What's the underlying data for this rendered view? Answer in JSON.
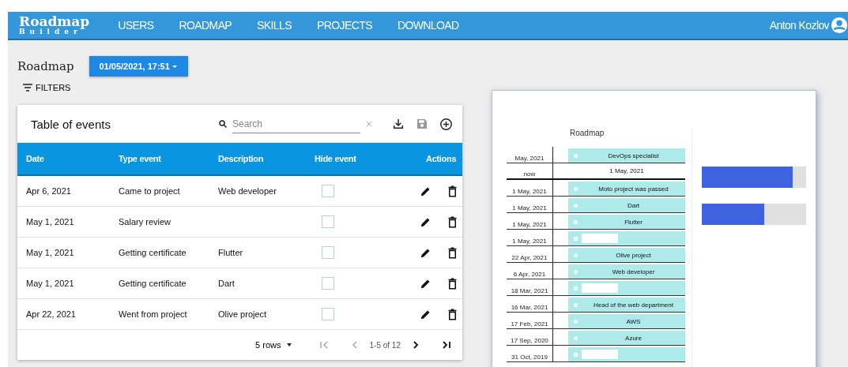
{
  "header": {
    "logo": {
      "title": "Roadmap",
      "subtitle": "Builder"
    },
    "nav": [
      {
        "label": "USERS",
        "selected": false
      },
      {
        "label": "ROADMAP",
        "selected": false
      },
      {
        "label": "SKILLS",
        "selected": false
      },
      {
        "label": "PROJECTS",
        "selected": false
      },
      {
        "label": "DOWNLOAD",
        "selected": false
      }
    ],
    "user": "Anton Kozlov"
  },
  "page_title": "Roadmap",
  "date_button": "01/05/2021, 17:51",
  "filters_button": "FILTERS",
  "table": {
    "title": "Table of events",
    "search": {
      "placeholder": "Search"
    },
    "columns": [
      "Date",
      "Type event",
      "Description",
      "Hide event",
      "Actions"
    ],
    "rows": [
      {
        "date": "Apr 6, 2021",
        "type": "Came to project",
        "description": "Web developer",
        "hidden": false
      },
      {
        "date": "May 1, 2021",
        "type": "Salary review",
        "hidden": false
      },
      {
        "date": "May 1, 2021",
        "type": "Getting certificate",
        "description": "Flutter",
        "hidden": false
      },
      {
        "date": "May 1, 2021",
        "type": "Getting certificate",
        "description": "Dart",
        "hidden": false
      },
      {
        "date": "Apr 22, 2021",
        "type": "Went from project",
        "description": "Olive project",
        "hidden": false
      }
    ],
    "pagination": {
      "rows_per_page": "5 rows",
      "range": "1-5 of 12"
    }
  },
  "preview": {
    "roadmap_title": "Roadmap",
    "timeline": [
      {
        "kind": "event",
        "date": "May, 2021",
        "label": "DevOps specialist"
      },
      {
        "kind": "now",
        "date": "now",
        "label": "1 May, 2021"
      },
      {
        "kind": "event",
        "date": "1 May, 2021",
        "label": "Moto project was passed"
      },
      {
        "kind": "event",
        "date": "1 May, 2021",
        "label": "Dart"
      },
      {
        "kind": "event",
        "date": "1 May, 2021",
        "label": "Flutter"
      },
      {
        "kind": "blank",
        "date": "1 May, 2021"
      },
      {
        "kind": "event",
        "date": "22 Apr, 2021",
        "label": "Olive project"
      },
      {
        "kind": "event",
        "date": "6 Apr, 2021",
        "label": "Web developer"
      },
      {
        "kind": "blank",
        "date": "18 Mar, 2021"
      },
      {
        "kind": "event",
        "date": "16 Mar, 2021",
        "label": "Head of the web department"
      },
      {
        "kind": "event",
        "date": "17 Feb, 2021",
        "label": "AWS"
      },
      {
        "kind": "event",
        "date": "17 Sep, 2020",
        "label": "Azure"
      },
      {
        "kind": "blank",
        "date": "31 Oct, 2019"
      }
    ],
    "skills": [
      {
        "level": 0.87
      },
      {
        "level": 0.6
      }
    ]
  }
}
